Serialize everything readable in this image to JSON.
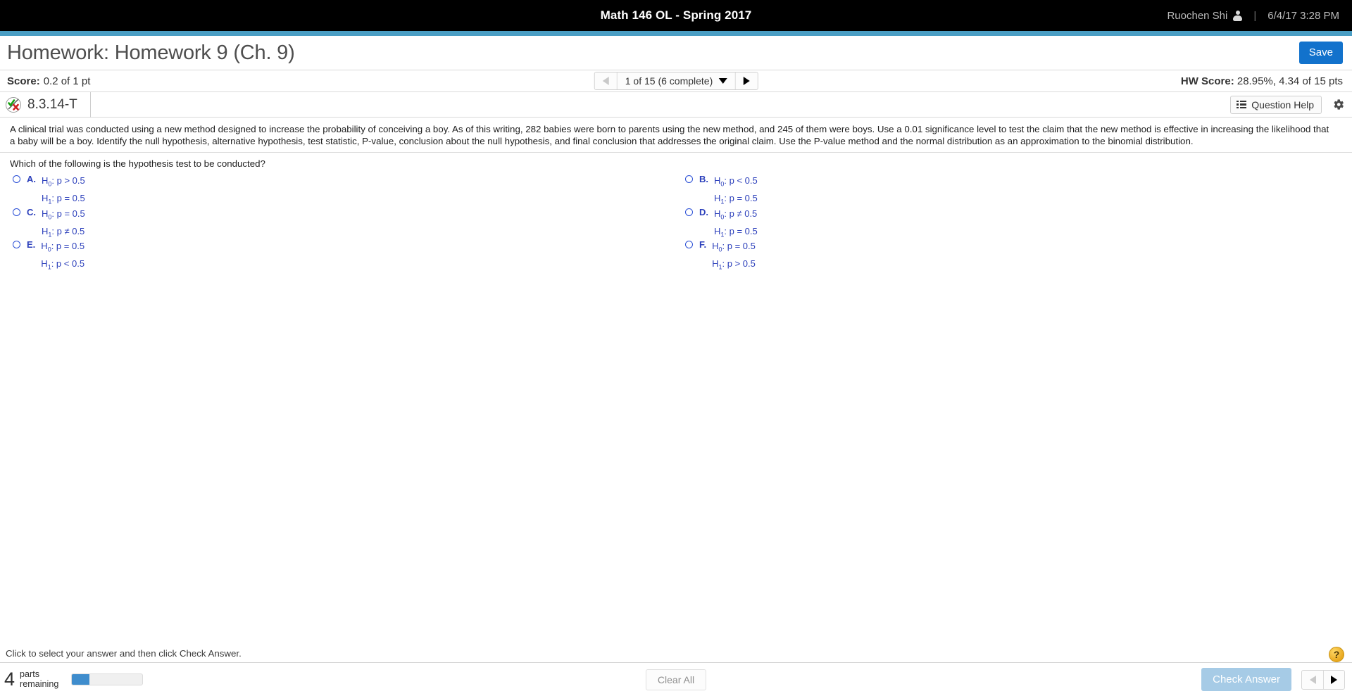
{
  "topbar": {
    "course_title": "Math 146 OL - Spring 2017",
    "user_name": "Ruochen Shi",
    "separator": "|",
    "timestamp": "6/4/17 3:28 PM",
    "person_icon": "person-icon"
  },
  "header": {
    "page_title": "Homework: Homework 9 (Ch. 9)",
    "save_label": "Save"
  },
  "scorebar": {
    "score_label": "Score:",
    "score_value": "0.2 of 1 pt",
    "nav_label": "1 of 15 (6 complete)",
    "prev_icon": "triangle-left-icon",
    "next_icon": "triangle-right-icon",
    "caret_icon": "caret-down-icon",
    "hw_score_label": "HW Score:",
    "hw_score_value": "28.95%, 4.34 of 15 pts"
  },
  "question_header": {
    "status_icon": "partially-correct-icon",
    "question_number": "8.3.14-T",
    "question_help_label": "Question Help",
    "list_icon": "list-icon",
    "gear_icon": "gear-icon"
  },
  "problem": {
    "statement": "A clinical trial was conducted using a new method designed to increase the probability of conceiving a boy. As of this writing, 282 babies were born to parents using the new method, and 245 of them were boys. Use a 0.01 significance level to test the claim that the new method is effective in increasing the likelihood that a baby will be a boy. Identify the null hypothesis, alternative hypothesis, test statistic, P-value, conclusion about the null hypothesis, and final conclusion that addresses the original claim. Use the P-value method and the normal distribution as an approximation to the binomial distribution."
  },
  "question": {
    "prompt": "Which of the following is the hypothesis test to be conducted?",
    "choices": [
      {
        "letter": "A.",
        "null_hyp": "H",
        "null_sub": "0",
        "null_rest": ": p > 0.5",
        "alt_hyp": "H",
        "alt_sub": "1",
        "alt_rest": ": p = 0.5",
        "selected": false
      },
      {
        "letter": "B.",
        "null_hyp": "H",
        "null_sub": "0",
        "null_rest": ": p < 0.5",
        "alt_hyp": "H",
        "alt_sub": "1",
        "alt_rest": ": p = 0.5",
        "selected": false
      },
      {
        "letter": "C.",
        "null_hyp": "H",
        "null_sub": "0",
        "null_rest": ": p = 0.5",
        "alt_hyp": "H",
        "alt_sub": "1",
        "alt_rest": ": p ≠ 0.5",
        "selected": false
      },
      {
        "letter": "D.",
        "null_hyp": "H",
        "null_sub": "0",
        "null_rest": ": p ≠ 0.5",
        "alt_hyp": "H",
        "alt_sub": "1",
        "alt_rest": ": p = 0.5",
        "selected": false
      },
      {
        "letter": "E.",
        "null_hyp": "H",
        "null_sub": "0",
        "null_rest": ": p = 0.5",
        "alt_hyp": "H",
        "alt_sub": "1",
        "alt_rest": ": p < 0.5",
        "selected": false
      },
      {
        "letter": "F.",
        "null_hyp": "H",
        "null_sub": "0",
        "null_rest": ": p = 0.5",
        "alt_hyp": "H",
        "alt_sub": "1",
        "alt_rest": ": p > 0.5",
        "selected": false
      }
    ]
  },
  "footer": {
    "instruction": "Click to select your answer and then click Check Answer.",
    "help_fab_label": "?",
    "parts_count": "4",
    "parts_word_1": "parts",
    "parts_word_2": "remaining",
    "progress_percent": 25,
    "clear_all_label": "Clear All",
    "check_answer_label": "Check Answer",
    "prev_icon": "triangle-left-icon",
    "next_icon": "triangle-right-icon"
  },
  "colors": {
    "accent_teal": "#4a9ec4",
    "save_blue": "#1272cc",
    "progress_blue": "#3f8dcd",
    "choice_blue": "#2b3fbb",
    "check_answer_disabled": "#a6cbe6",
    "help_yellow": "#e8a81f"
  }
}
